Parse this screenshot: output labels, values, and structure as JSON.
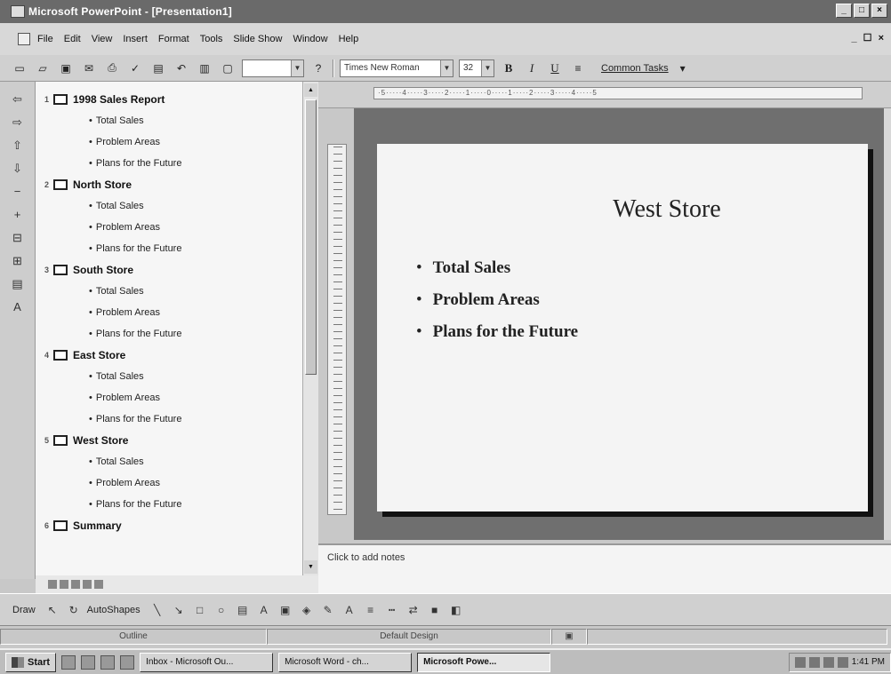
{
  "window": {
    "title": "Microsoft PowerPoint - [Presentation1]",
    "controls": [
      "_",
      "□",
      "×"
    ]
  },
  "menu": {
    "items": [
      "File",
      "Edit",
      "View",
      "Insert",
      "Format",
      "Tools",
      "Slide Show",
      "Window",
      "Help"
    ],
    "mdi_controls": "_ ☐ ×"
  },
  "toolbar": {
    "zoom_value": "",
    "font_name": "Times New Roman",
    "font_size": "32",
    "bold_label": "B",
    "italic_label": "I",
    "underline_label": "U",
    "common_tasks": "Common Tasks"
  },
  "outline": {
    "slides": [
      {
        "num": "1",
        "title": "1998 Sales Report",
        "bullets": [
          "Total Sales",
          "Problem Areas",
          "Plans for the Future"
        ]
      },
      {
        "num": "2",
        "title": "North Store",
        "bullets": [
          "Total Sales",
          "Problem Areas",
          "Plans for the Future"
        ]
      },
      {
        "num": "3",
        "title": "South Store",
        "bullets": [
          "Total Sales",
          "Problem Areas",
          "Plans for the Future"
        ]
      },
      {
        "num": "4",
        "title": "East Store",
        "bullets": [
          "Total Sales",
          "Problem Areas",
          "Plans for the Future"
        ]
      },
      {
        "num": "5",
        "title": "West Store",
        "bullets": [
          "Total Sales",
          "Problem Areas",
          "Plans for the Future"
        ]
      },
      {
        "num": "6",
        "title": "Summary",
        "bullets": []
      }
    ]
  },
  "ruler": {
    "marks": "·5·····4·····3·····2·····1·····0·····1·····2·····3·····4·····5"
  },
  "slide": {
    "title": "West Store",
    "bullets": [
      "Total Sales",
      "Problem Areas",
      "Plans for the Future"
    ]
  },
  "notes": {
    "placeholder": "Click to add notes"
  },
  "drawing": {
    "draw_label": "Draw",
    "autoshapes_label": "AutoShapes"
  },
  "status": {
    "view": "Outline",
    "design": "Default Design"
  },
  "taskbar": {
    "start": "Start",
    "tasks": [
      {
        "label": "Inbox - Microsoft Ou...",
        "active": false
      },
      {
        "label": "Microsoft Word - ch...",
        "active": false
      },
      {
        "label": "Microsoft Powe...",
        "active": true
      }
    ],
    "clock": "1:41 PM"
  }
}
